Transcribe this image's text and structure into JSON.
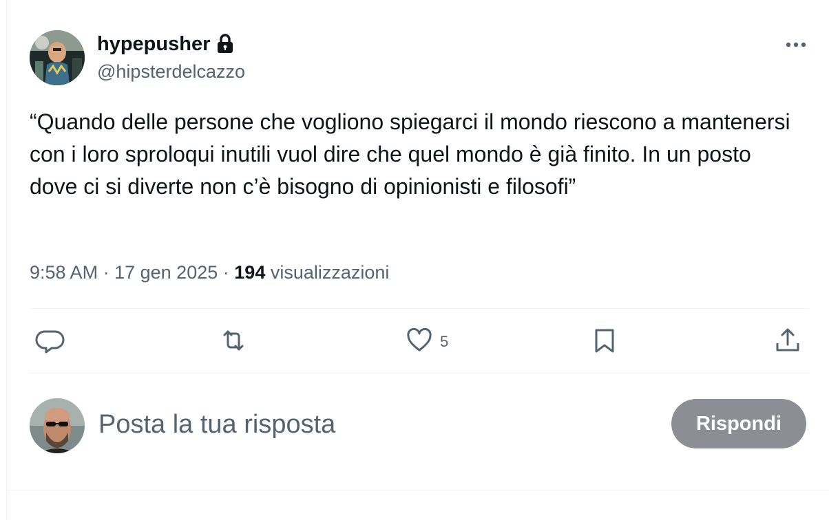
{
  "author": {
    "display_name": "hypepusher",
    "handle": "@hipsterdelcazzo",
    "protected_icon": "lock-icon"
  },
  "tweet": {
    "text": "“Quando delle persone che vogliono spiegarci il mondo riescono a mantenersi con i loro sproloqui inutili vuol dire che quel mondo è già finito. In un posto dove ci si diverte non c’è bisogno di opinionisti e filosofi”",
    "time": "9:58 AM",
    "separator": "·",
    "date": "17 gen 2025",
    "views_count": "194",
    "views_label": "visualizzazioni"
  },
  "actions": {
    "reply_icon": "comment-icon",
    "retweet_icon": "retweet-icon",
    "like_icon": "heart-icon",
    "like_count": "5",
    "bookmark_icon": "bookmark-icon",
    "share_icon": "share-icon"
  },
  "composer": {
    "placeholder": "Posta la tua risposta",
    "value": "",
    "button_label": "Rispondi"
  },
  "colors": {
    "text_primary": "#0f1419",
    "text_secondary": "#536471",
    "divider": "#eff3f4",
    "button_disabled": "#8b8f93"
  }
}
